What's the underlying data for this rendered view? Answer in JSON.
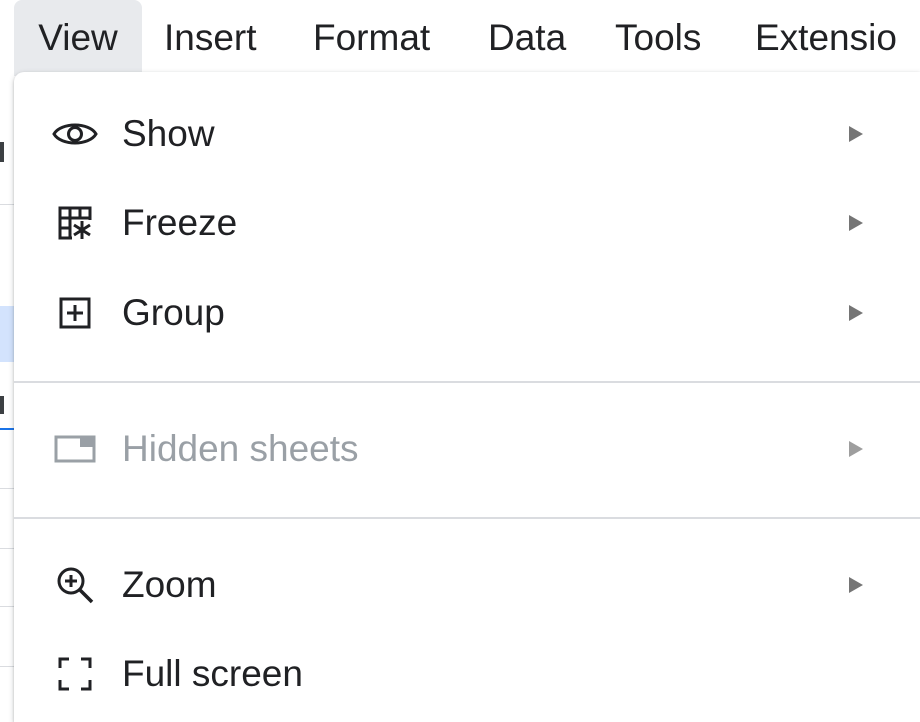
{
  "menubar": {
    "items": [
      {
        "label": "View",
        "active": true
      },
      {
        "label": "Insert"
      },
      {
        "label": "Format"
      },
      {
        "label": "Data"
      },
      {
        "label": "Tools"
      },
      {
        "label": "Extensio"
      }
    ]
  },
  "view_menu": {
    "items": [
      {
        "label": "Show",
        "icon": "eye-icon",
        "has_submenu": true,
        "enabled": true
      },
      {
        "label": "Freeze",
        "icon": "freeze-grid-icon",
        "has_submenu": true,
        "enabled": true
      },
      {
        "label": "Group",
        "icon": "plus-box-icon",
        "has_submenu": true,
        "enabled": true
      },
      {
        "label": "Hidden sheets",
        "icon": "hidden-sheet-icon",
        "has_submenu": true,
        "enabled": false
      },
      {
        "label": "Zoom",
        "icon": "zoom-in-icon",
        "has_submenu": true,
        "enabled": true
      },
      {
        "label": "Full screen",
        "icon": "fullscreen-icon",
        "has_submenu": false,
        "enabled": true
      }
    ]
  },
  "colors": {
    "text": "#202124",
    "disabled_text": "#9aa0a6",
    "active_menubar_bg": "#e8eaed",
    "separator": "#dadce0",
    "submenu_arrow": "#757575"
  }
}
